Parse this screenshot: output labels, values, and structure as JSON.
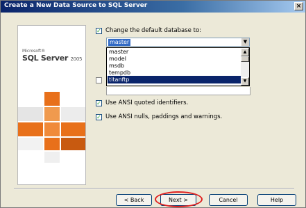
{
  "window": {
    "title": "Create a New Data Source to SQL Server",
    "close_glyph": "×"
  },
  "branding": {
    "company": "Microsoft®",
    "product": "SQL Server",
    "version": "2005"
  },
  "options": {
    "change_default_db_label": "Change the default database to:",
    "change_default_db_checked": true,
    "selected_database": "master",
    "database_list": [
      "master",
      "model",
      "msdb",
      "tempdb",
      "titanftp"
    ],
    "highlighted_item": "titanftp",
    "ansi_quoted_label": "Use ANSI quoted identifiers.",
    "ansi_quoted_checked": true,
    "ansi_nulls_label": "Use ANSI nulls, paddings and warnings.",
    "ansi_nulls_checked": true
  },
  "buttons": {
    "back": "< Back",
    "next": "Next >",
    "cancel": "Cancel",
    "help": "Help"
  },
  "colors": {
    "title_bar": "#0a246a",
    "selection": "#0a246a",
    "highlight_ring": "#e02020",
    "accent_orange": "#e8701a"
  },
  "icons": {
    "check": "✓",
    "dropdown": "▼",
    "scroll_up": "▲",
    "scroll_down": "▼"
  }
}
